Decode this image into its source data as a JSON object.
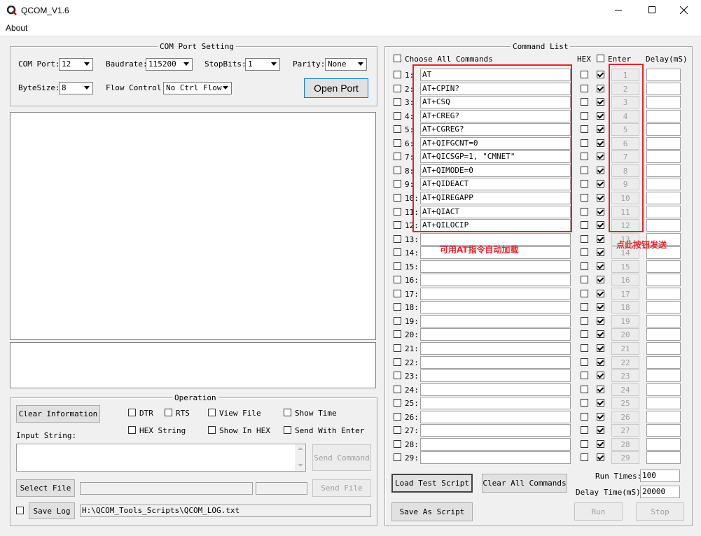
{
  "window": {
    "title": "QCOM_V1.6"
  },
  "menu": {
    "about": "About"
  },
  "com_port_setting": {
    "legend": "COM Port Setting",
    "com_port_label": "COM Port:",
    "com_port_value": "12",
    "baudrate_label": "Baudrate:",
    "baudrate_value": "115200",
    "stopbits_label": "StopBits:",
    "stopbits_value": "1",
    "parity_label": "Parity:",
    "parity_value": "None",
    "bytesize_label": "ByteSize:",
    "bytesize_value": "8",
    "flow_label": "Flow Control:",
    "flow_value": "No Ctrl Flow",
    "open_port": "Open Port"
  },
  "operation": {
    "legend": "Operation",
    "clear_information": "Clear Information",
    "dtr": "DTR",
    "rts": "RTS",
    "view_file": "View File",
    "show_time": "Show Time",
    "hex_string": "HEX String",
    "show_in_hex": "Show In HEX",
    "send_with_enter": "Send With Enter",
    "input_string_label": "Input String:",
    "send_command": "Send Command",
    "select_file": "Select File",
    "send_file": "Send File",
    "save_log": "Save Log",
    "log_path": "H:\\QCOM_Tools_Scripts\\QCOM_LOG.txt"
  },
  "command_list": {
    "legend": "Command List",
    "choose_all": "Choose All Commands",
    "hex_header": "HEX",
    "enter_header": "Enter",
    "delay_header": "Delay(mS)",
    "rows": [
      {
        "num": "1:",
        "cmd": "AT",
        "btn": "1"
      },
      {
        "num": "2:",
        "cmd": "AT+CPIN?",
        "btn": "2"
      },
      {
        "num": "3:",
        "cmd": "AT+CSQ",
        "btn": "3"
      },
      {
        "num": "4:",
        "cmd": "AT+CREG?",
        "btn": "4"
      },
      {
        "num": "5:",
        "cmd": "AT+CGREG?",
        "btn": "5"
      },
      {
        "num": "6:",
        "cmd": "AT+QIFGCNT=0",
        "btn": "6"
      },
      {
        "num": "7:",
        "cmd": "AT+QICSGP=1, \"CMNET\"",
        "btn": "7"
      },
      {
        "num": "8:",
        "cmd": "AT+QIMODE=0",
        "btn": "8"
      },
      {
        "num": "9:",
        "cmd": "AT+QIDEACT",
        "btn": "9"
      },
      {
        "num": "10:",
        "cmd": "AT+QIREGAPP",
        "btn": "10"
      },
      {
        "num": "11:",
        "cmd": "AT+QIACT",
        "btn": "11"
      },
      {
        "num": "12:",
        "cmd": "AT+QILOCIP",
        "btn": "12"
      },
      {
        "num": "13:",
        "cmd": "",
        "btn": "13"
      },
      {
        "num": "14:",
        "cmd": "",
        "btn": "14"
      },
      {
        "num": "15:",
        "cmd": "",
        "btn": "15"
      },
      {
        "num": "16:",
        "cmd": "",
        "btn": "16"
      },
      {
        "num": "17:",
        "cmd": "",
        "btn": "17"
      },
      {
        "num": "18:",
        "cmd": "",
        "btn": "18"
      },
      {
        "num": "19:",
        "cmd": "",
        "btn": "19"
      },
      {
        "num": "20:",
        "cmd": "",
        "btn": "20"
      },
      {
        "num": "21:",
        "cmd": "",
        "btn": "21"
      },
      {
        "num": "22:",
        "cmd": "",
        "btn": "22"
      },
      {
        "num": "23:",
        "cmd": "",
        "btn": "23"
      },
      {
        "num": "24:",
        "cmd": "",
        "btn": "24"
      },
      {
        "num": "25:",
        "cmd": "",
        "btn": "25"
      },
      {
        "num": "26:",
        "cmd": "",
        "btn": "26"
      },
      {
        "num": "27:",
        "cmd": "",
        "btn": "27"
      },
      {
        "num": "28:",
        "cmd": "",
        "btn": "28"
      },
      {
        "num": "29:",
        "cmd": "",
        "btn": "29"
      }
    ],
    "load_test_script": "Load Test Script",
    "clear_all_commands": "Clear All Commands",
    "save_as_script": "Save As Script",
    "run_times_label": "Run Times:",
    "run_times_value": "100",
    "delay_time_label": "Delay Time(mS):",
    "delay_time_value": "20000",
    "run": "Run",
    "stop": "Stop"
  },
  "annotations": {
    "auto_load_note": "可用AT指令自动加载",
    "click_send_note": "点此按钮发送",
    "color": "#e0262b"
  }
}
